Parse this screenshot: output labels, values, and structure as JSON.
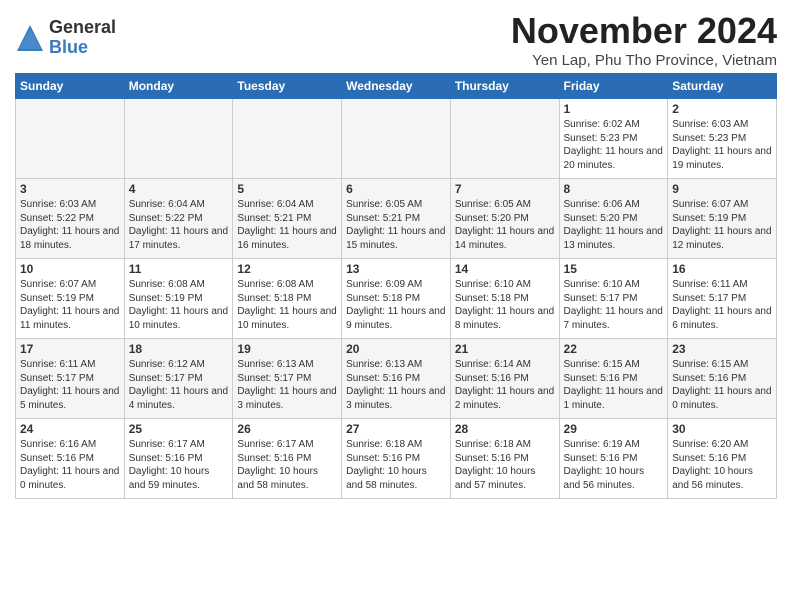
{
  "logo": {
    "general": "General",
    "blue": "Blue"
  },
  "title": "November 2024",
  "location": "Yen Lap, Phu Tho Province, Vietnam",
  "headers": [
    "Sunday",
    "Monday",
    "Tuesday",
    "Wednesday",
    "Thursday",
    "Friday",
    "Saturday"
  ],
  "weeks": [
    [
      {
        "day": "",
        "empty": true
      },
      {
        "day": "",
        "empty": true
      },
      {
        "day": "",
        "empty": true
      },
      {
        "day": "",
        "empty": true
      },
      {
        "day": "",
        "empty": true
      },
      {
        "day": "1",
        "sunrise": "Sunrise: 6:02 AM",
        "sunset": "Sunset: 5:23 PM",
        "daylight": "Daylight: 11 hours and 20 minutes."
      },
      {
        "day": "2",
        "sunrise": "Sunrise: 6:03 AM",
        "sunset": "Sunset: 5:23 PM",
        "daylight": "Daylight: 11 hours and 19 minutes."
      }
    ],
    [
      {
        "day": "3",
        "sunrise": "Sunrise: 6:03 AM",
        "sunset": "Sunset: 5:22 PM",
        "daylight": "Daylight: 11 hours and 18 minutes."
      },
      {
        "day": "4",
        "sunrise": "Sunrise: 6:04 AM",
        "sunset": "Sunset: 5:22 PM",
        "daylight": "Daylight: 11 hours and 17 minutes."
      },
      {
        "day": "5",
        "sunrise": "Sunrise: 6:04 AM",
        "sunset": "Sunset: 5:21 PM",
        "daylight": "Daylight: 11 hours and 16 minutes."
      },
      {
        "day": "6",
        "sunrise": "Sunrise: 6:05 AM",
        "sunset": "Sunset: 5:21 PM",
        "daylight": "Daylight: 11 hours and 15 minutes."
      },
      {
        "day": "7",
        "sunrise": "Sunrise: 6:05 AM",
        "sunset": "Sunset: 5:20 PM",
        "daylight": "Daylight: 11 hours and 14 minutes."
      },
      {
        "day": "8",
        "sunrise": "Sunrise: 6:06 AM",
        "sunset": "Sunset: 5:20 PM",
        "daylight": "Daylight: 11 hours and 13 minutes."
      },
      {
        "day": "9",
        "sunrise": "Sunrise: 6:07 AM",
        "sunset": "Sunset: 5:19 PM",
        "daylight": "Daylight: 11 hours and 12 minutes."
      }
    ],
    [
      {
        "day": "10",
        "sunrise": "Sunrise: 6:07 AM",
        "sunset": "Sunset: 5:19 PM",
        "daylight": "Daylight: 11 hours and 11 minutes."
      },
      {
        "day": "11",
        "sunrise": "Sunrise: 6:08 AM",
        "sunset": "Sunset: 5:19 PM",
        "daylight": "Daylight: 11 hours and 10 minutes."
      },
      {
        "day": "12",
        "sunrise": "Sunrise: 6:08 AM",
        "sunset": "Sunset: 5:18 PM",
        "daylight": "Daylight: 11 hours and 10 minutes."
      },
      {
        "day": "13",
        "sunrise": "Sunrise: 6:09 AM",
        "sunset": "Sunset: 5:18 PM",
        "daylight": "Daylight: 11 hours and 9 minutes."
      },
      {
        "day": "14",
        "sunrise": "Sunrise: 6:10 AM",
        "sunset": "Sunset: 5:18 PM",
        "daylight": "Daylight: 11 hours and 8 minutes."
      },
      {
        "day": "15",
        "sunrise": "Sunrise: 6:10 AM",
        "sunset": "Sunset: 5:17 PM",
        "daylight": "Daylight: 11 hours and 7 minutes."
      },
      {
        "day": "16",
        "sunrise": "Sunrise: 6:11 AM",
        "sunset": "Sunset: 5:17 PM",
        "daylight": "Daylight: 11 hours and 6 minutes."
      }
    ],
    [
      {
        "day": "17",
        "sunrise": "Sunrise: 6:11 AM",
        "sunset": "Sunset: 5:17 PM",
        "daylight": "Daylight: 11 hours and 5 minutes."
      },
      {
        "day": "18",
        "sunrise": "Sunrise: 6:12 AM",
        "sunset": "Sunset: 5:17 PM",
        "daylight": "Daylight: 11 hours and 4 minutes."
      },
      {
        "day": "19",
        "sunrise": "Sunrise: 6:13 AM",
        "sunset": "Sunset: 5:17 PM",
        "daylight": "Daylight: 11 hours and 3 minutes."
      },
      {
        "day": "20",
        "sunrise": "Sunrise: 6:13 AM",
        "sunset": "Sunset: 5:16 PM",
        "daylight": "Daylight: 11 hours and 3 minutes."
      },
      {
        "day": "21",
        "sunrise": "Sunrise: 6:14 AM",
        "sunset": "Sunset: 5:16 PM",
        "daylight": "Daylight: 11 hours and 2 minutes."
      },
      {
        "day": "22",
        "sunrise": "Sunrise: 6:15 AM",
        "sunset": "Sunset: 5:16 PM",
        "daylight": "Daylight: 11 hours and 1 minute."
      },
      {
        "day": "23",
        "sunrise": "Sunrise: 6:15 AM",
        "sunset": "Sunset: 5:16 PM",
        "daylight": "Daylight: 11 hours and 0 minutes."
      }
    ],
    [
      {
        "day": "24",
        "sunrise": "Sunrise: 6:16 AM",
        "sunset": "Sunset: 5:16 PM",
        "daylight": "Daylight: 11 hours and 0 minutes."
      },
      {
        "day": "25",
        "sunrise": "Sunrise: 6:17 AM",
        "sunset": "Sunset: 5:16 PM",
        "daylight": "Daylight: 10 hours and 59 minutes."
      },
      {
        "day": "26",
        "sunrise": "Sunrise: 6:17 AM",
        "sunset": "Sunset: 5:16 PM",
        "daylight": "Daylight: 10 hours and 58 minutes."
      },
      {
        "day": "27",
        "sunrise": "Sunrise: 6:18 AM",
        "sunset": "Sunset: 5:16 PM",
        "daylight": "Daylight: 10 hours and 58 minutes."
      },
      {
        "day": "28",
        "sunrise": "Sunrise: 6:18 AM",
        "sunset": "Sunset: 5:16 PM",
        "daylight": "Daylight: 10 hours and 57 minutes."
      },
      {
        "day": "29",
        "sunrise": "Sunrise: 6:19 AM",
        "sunset": "Sunset: 5:16 PM",
        "daylight": "Daylight: 10 hours and 56 minutes."
      },
      {
        "day": "30",
        "sunrise": "Sunrise: 6:20 AM",
        "sunset": "Sunset: 5:16 PM",
        "daylight": "Daylight: 10 hours and 56 minutes."
      }
    ]
  ]
}
